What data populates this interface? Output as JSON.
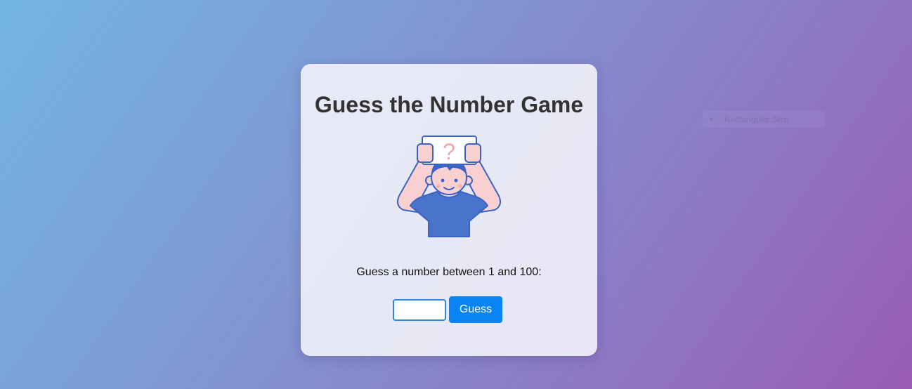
{
  "game": {
    "title": "Guess the Number Game",
    "prompt": "Guess a number between 1 and 100:",
    "input_value": "",
    "input_placeholder": "",
    "button_label": "Guess",
    "illustration_icon": "person-holding-question-card",
    "question_mark": "?"
  },
  "overlay": {
    "snip_label": "Rectangular Snip",
    "snip_icon": "triangle-down-icon"
  },
  "colors": {
    "background_start": "#73b5e4",
    "background_end": "#9a5cb6",
    "card": "#eeeef6",
    "title": "#333333",
    "button": "#0a84f5",
    "input_border": "#2d86d8",
    "shirt": "#4a74cc",
    "skin": "#f8d0d2",
    "outline": "#3a64c0",
    "question_mark": "#f0a6aa"
  }
}
